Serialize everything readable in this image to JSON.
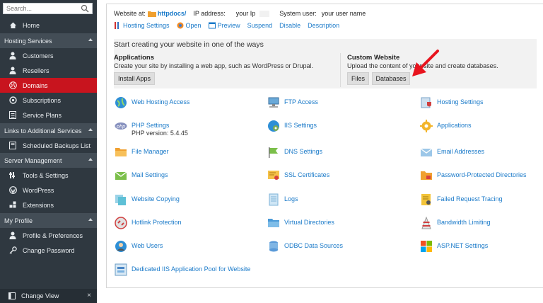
{
  "sidebar": {
    "search_placeholder": "Search...",
    "items": [
      {
        "label": "Home"
      },
      {
        "label": "Customers"
      },
      {
        "label": "Resellers"
      },
      {
        "label": "Domains"
      },
      {
        "label": "Subscriptions"
      },
      {
        "label": "Service Plans"
      },
      {
        "label": "Scheduled Backups List"
      },
      {
        "label": "Tools & Settings"
      },
      {
        "label": "WordPress"
      },
      {
        "label": "Extensions"
      },
      {
        "label": "Profile & Preferences"
      },
      {
        "label": "Change Password"
      }
    ],
    "sections": [
      {
        "label": "Hosting Services"
      },
      {
        "label": "Links to Additional Services"
      },
      {
        "label": "Server Management"
      },
      {
        "label": "My Profile"
      }
    ],
    "change_view": "Change View",
    "close_glyph": "×"
  },
  "header": {
    "website_at": "Website at:",
    "httpdocs": "httpdocs/",
    "ip_label": "IP address:",
    "ip_value": "your Ip",
    "user_label": "System user:",
    "user_value": "your user name"
  },
  "links": [
    "Hosting Settings",
    "Open",
    "Preview",
    "Suspend",
    "Disable",
    "Description"
  ],
  "start": {
    "title": "Start creating your website in one of the ways",
    "applications_title": "Applications",
    "applications_desc": "Create your site by installing a web app, such as WordPress or Drupal.",
    "install_apps": "Install Apps",
    "custom_title": "Custom Website",
    "custom_desc": "Upload the content of your site and create databases.",
    "files": "Files",
    "databases": "Databases"
  },
  "tools": {
    "col1": [
      "Web Hosting Access",
      "PHP Settings",
      "File Manager",
      "Mail Settings",
      "Website Copying",
      "Hotlink Protection",
      "Web Users",
      "Dedicated IIS Application Pool for Website"
    ],
    "php_version": "PHP version: 5.4.45",
    "col2": [
      "FTP Access",
      "IIS Settings",
      "DNS Settings",
      "SSL Certificates",
      "Logs",
      "Virtual Directories",
      "ODBC Data Sources"
    ],
    "col3": [
      "Hosting Settings",
      "Applications",
      "Email Addresses",
      "Password-Protected Directories",
      "Failed Request Tracing",
      "Bandwidth Limiting",
      "ASP.NET Settings"
    ]
  },
  "colors": {
    "accent": "#1a7ac9",
    "active": "#c8141e",
    "sidebar": "#2f3840",
    "arrow": "#e8141e"
  }
}
